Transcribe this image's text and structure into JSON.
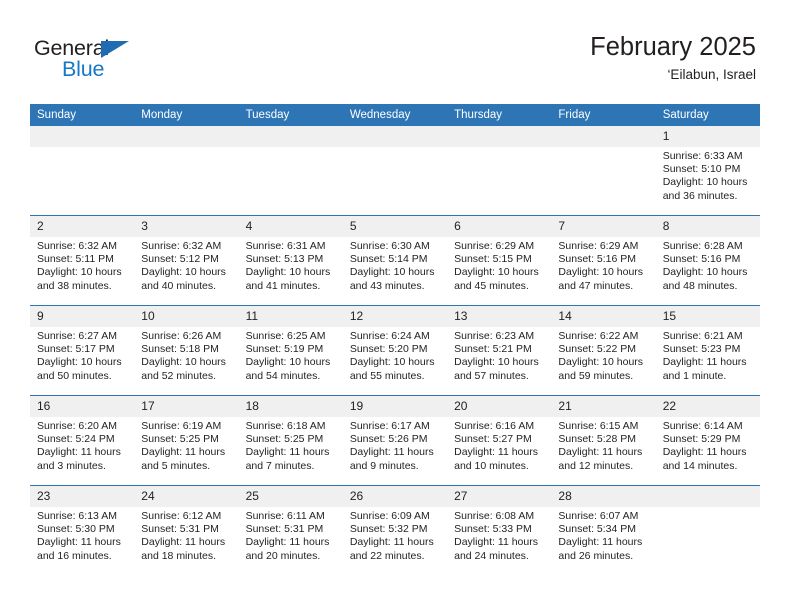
{
  "logo": {
    "text_top": "General",
    "text_bottom": "Blue",
    "triangle_color": "#1f6cb4",
    "blue_color": "#1878c8"
  },
  "header": {
    "title": "February 2025",
    "subtitle": "‘Eilabun, Israel"
  },
  "theme": {
    "header_blue": "#2e75b6",
    "daynum_band": "#f0f0f0",
    "text": "#231f20"
  },
  "weekdays": [
    "Sunday",
    "Monday",
    "Tuesday",
    "Wednesday",
    "Thursday",
    "Friday",
    "Saturday"
  ],
  "labels": {
    "sunrise": "Sunrise:",
    "sunset": "Sunset:",
    "daylight": "Daylight:"
  },
  "weeks": [
    [
      {
        "day": "",
        "empty": true
      },
      {
        "day": "",
        "empty": true
      },
      {
        "day": "",
        "empty": true
      },
      {
        "day": "",
        "empty": true
      },
      {
        "day": "",
        "empty": true
      },
      {
        "day": "",
        "empty": true
      },
      {
        "day": "1",
        "sunrise": "Sunrise: 6:33 AM",
        "sunset": "Sunset: 5:10 PM",
        "daylight": "Daylight: 10 hours and 36 minutes."
      }
    ],
    [
      {
        "day": "2",
        "sunrise": "Sunrise: 6:32 AM",
        "sunset": "Sunset: 5:11 PM",
        "daylight": "Daylight: 10 hours and 38 minutes."
      },
      {
        "day": "3",
        "sunrise": "Sunrise: 6:32 AM",
        "sunset": "Sunset: 5:12 PM",
        "daylight": "Daylight: 10 hours and 40 minutes."
      },
      {
        "day": "4",
        "sunrise": "Sunrise: 6:31 AM",
        "sunset": "Sunset: 5:13 PM",
        "daylight": "Daylight: 10 hours and 41 minutes."
      },
      {
        "day": "5",
        "sunrise": "Sunrise: 6:30 AM",
        "sunset": "Sunset: 5:14 PM",
        "daylight": "Daylight: 10 hours and 43 minutes."
      },
      {
        "day": "6",
        "sunrise": "Sunrise: 6:29 AM",
        "sunset": "Sunset: 5:15 PM",
        "daylight": "Daylight: 10 hours and 45 minutes."
      },
      {
        "day": "7",
        "sunrise": "Sunrise: 6:29 AM",
        "sunset": "Sunset: 5:16 PM",
        "daylight": "Daylight: 10 hours and 47 minutes."
      },
      {
        "day": "8",
        "sunrise": "Sunrise: 6:28 AM",
        "sunset": "Sunset: 5:16 PM",
        "daylight": "Daylight: 10 hours and 48 minutes."
      }
    ],
    [
      {
        "day": "9",
        "sunrise": "Sunrise: 6:27 AM",
        "sunset": "Sunset: 5:17 PM",
        "daylight": "Daylight: 10 hours and 50 minutes."
      },
      {
        "day": "10",
        "sunrise": "Sunrise: 6:26 AM",
        "sunset": "Sunset: 5:18 PM",
        "daylight": "Daylight: 10 hours and 52 minutes."
      },
      {
        "day": "11",
        "sunrise": "Sunrise: 6:25 AM",
        "sunset": "Sunset: 5:19 PM",
        "daylight": "Daylight: 10 hours and 54 minutes."
      },
      {
        "day": "12",
        "sunrise": "Sunrise: 6:24 AM",
        "sunset": "Sunset: 5:20 PM",
        "daylight": "Daylight: 10 hours and 55 minutes."
      },
      {
        "day": "13",
        "sunrise": "Sunrise: 6:23 AM",
        "sunset": "Sunset: 5:21 PM",
        "daylight": "Daylight: 10 hours and 57 minutes."
      },
      {
        "day": "14",
        "sunrise": "Sunrise: 6:22 AM",
        "sunset": "Sunset: 5:22 PM",
        "daylight": "Daylight: 10 hours and 59 minutes."
      },
      {
        "day": "15",
        "sunrise": "Sunrise: 6:21 AM",
        "sunset": "Sunset: 5:23 PM",
        "daylight": "Daylight: 11 hours and 1 minute."
      }
    ],
    [
      {
        "day": "16",
        "sunrise": "Sunrise: 6:20 AM",
        "sunset": "Sunset: 5:24 PM",
        "daylight": "Daylight: 11 hours and 3 minutes."
      },
      {
        "day": "17",
        "sunrise": "Sunrise: 6:19 AM",
        "sunset": "Sunset: 5:25 PM",
        "daylight": "Daylight: 11 hours and 5 minutes."
      },
      {
        "day": "18",
        "sunrise": "Sunrise: 6:18 AM",
        "sunset": "Sunset: 5:25 PM",
        "daylight": "Daylight: 11 hours and 7 minutes."
      },
      {
        "day": "19",
        "sunrise": "Sunrise: 6:17 AM",
        "sunset": "Sunset: 5:26 PM",
        "daylight": "Daylight: 11 hours and 9 minutes."
      },
      {
        "day": "20",
        "sunrise": "Sunrise: 6:16 AM",
        "sunset": "Sunset: 5:27 PM",
        "daylight": "Daylight: 11 hours and 10 minutes."
      },
      {
        "day": "21",
        "sunrise": "Sunrise: 6:15 AM",
        "sunset": "Sunset: 5:28 PM",
        "daylight": "Daylight: 11 hours and 12 minutes."
      },
      {
        "day": "22",
        "sunrise": "Sunrise: 6:14 AM",
        "sunset": "Sunset: 5:29 PM",
        "daylight": "Daylight: 11 hours and 14 minutes."
      }
    ],
    [
      {
        "day": "23",
        "sunrise": "Sunrise: 6:13 AM",
        "sunset": "Sunset: 5:30 PM",
        "daylight": "Daylight: 11 hours and 16 minutes."
      },
      {
        "day": "24",
        "sunrise": "Sunrise: 6:12 AM",
        "sunset": "Sunset: 5:31 PM",
        "daylight": "Daylight: 11 hours and 18 minutes."
      },
      {
        "day": "25",
        "sunrise": "Sunrise: 6:11 AM",
        "sunset": "Sunset: 5:31 PM",
        "daylight": "Daylight: 11 hours and 20 minutes."
      },
      {
        "day": "26",
        "sunrise": "Sunrise: 6:09 AM",
        "sunset": "Sunset: 5:32 PM",
        "daylight": "Daylight: 11 hours and 22 minutes."
      },
      {
        "day": "27",
        "sunrise": "Sunrise: 6:08 AM",
        "sunset": "Sunset: 5:33 PM",
        "daylight": "Daylight: 11 hours and 24 minutes."
      },
      {
        "day": "28",
        "sunrise": "Sunrise: 6:07 AM",
        "sunset": "Sunset: 5:34 PM",
        "daylight": "Daylight: 11 hours and 26 minutes."
      },
      {
        "day": "",
        "empty": true
      }
    ]
  ]
}
